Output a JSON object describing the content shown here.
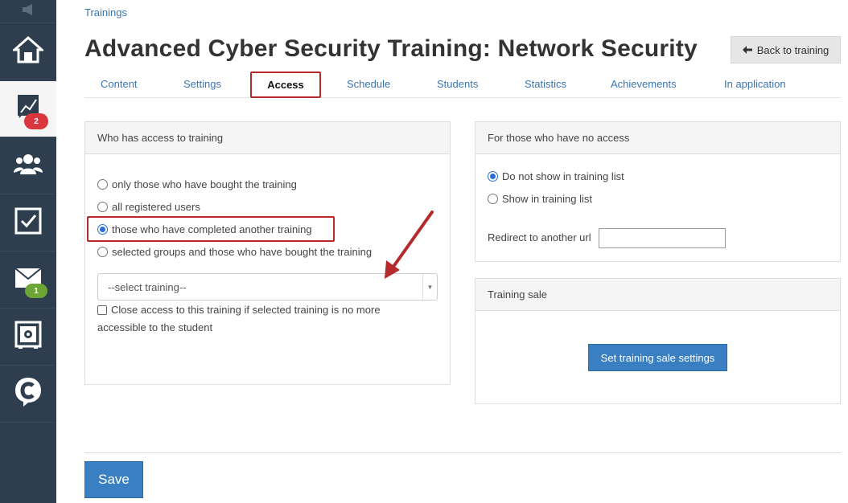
{
  "sidebar": {
    "items": [
      {
        "icon": "megaphone-icon"
      },
      {
        "icon": "home-icon"
      },
      {
        "icon": "chart-icon",
        "badge": "2"
      },
      {
        "icon": "users-icon"
      },
      {
        "icon": "checkbox-icon"
      },
      {
        "icon": "mail-icon",
        "badge": "1"
      },
      {
        "icon": "safe-icon"
      },
      {
        "icon": "chat-c-icon"
      }
    ]
  },
  "breadcrumb": "Trainings",
  "title": "Advanced Cyber Security Training: Network Security",
  "back_button": "Back to training",
  "tabs": [
    {
      "label": "Content"
    },
    {
      "label": "Settings"
    },
    {
      "label": "Access",
      "active": true
    },
    {
      "label": "Schedule"
    },
    {
      "label": "Students"
    },
    {
      "label": "Statistics"
    },
    {
      "label": "Achievements"
    },
    {
      "label": "In application"
    }
  ],
  "access_panel": {
    "title": "Who has access to training",
    "options": [
      {
        "label": "only those who have bought the training",
        "selected": false
      },
      {
        "label": "all registered users",
        "selected": false
      },
      {
        "label": "those who have completed another training",
        "selected": true
      },
      {
        "label": "selected groups and those who have bought the training",
        "selected": false
      }
    ],
    "select_placeholder": "--select training--",
    "checkbox_label_1": "Close access to this training if selected training is no more",
    "checkbox_label_2": "accessible to the student"
  },
  "no_access_panel": {
    "title": "For those who have no access",
    "options": [
      {
        "label": "Do not show in training list",
        "selected": true
      },
      {
        "label": "Show in training list",
        "selected": false
      }
    ],
    "redirect_label": "Redirect to another url",
    "redirect_value": ""
  },
  "sale_panel": {
    "title": "Training sale",
    "button": "Set training sale settings"
  },
  "save_button": "Save",
  "colors": {
    "accent": "#3a7fc1",
    "highlight": "#b52a2a",
    "sidebar": "#2e3e4e"
  }
}
